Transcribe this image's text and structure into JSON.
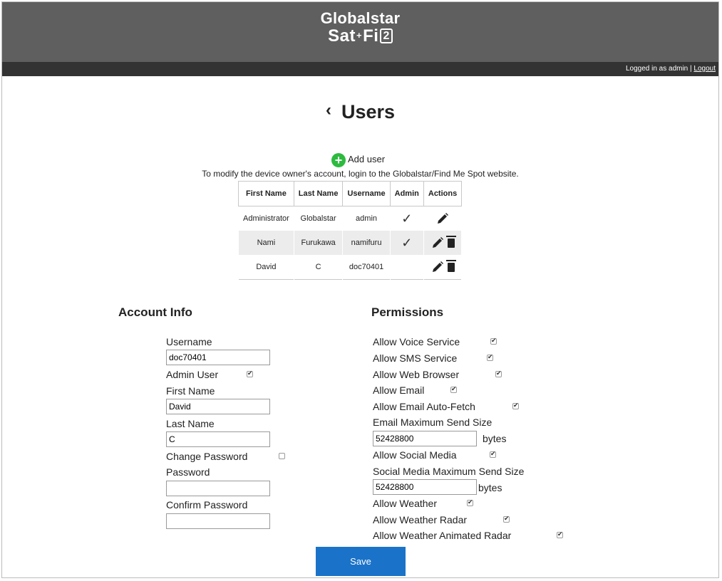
{
  "header": {
    "logo_line1": "Globalstar",
    "logo_line2_a": "Sat",
    "logo_line2_plus": "+",
    "logo_line2_b": "Fi",
    "logo_line2_num": "2",
    "status_text": "Logged in as admin | ",
    "logout_label": "Logout",
    "bg_color": "#5f5f5f",
    "status_bg_color": "#333333"
  },
  "page": {
    "back_glyph": "‹",
    "title": "Users",
    "add_user_label": "Add user",
    "notice": "To modify the device owner's account, login to the Globalstar/Find Me Spot website."
  },
  "table": {
    "headers": [
      "First Name",
      "Last Name",
      "Username",
      "Admin",
      "Actions"
    ],
    "rows": [
      {
        "first": "Administrator",
        "last": "Globalstar",
        "username": "admin",
        "admin": "✓",
        "edit": true,
        "delete": false
      },
      {
        "first": "Nami",
        "last": "Furukawa",
        "username": "namifuru",
        "admin": "✓",
        "edit": true,
        "delete": true
      },
      {
        "first": "David",
        "last": "C",
        "username": "doc70401",
        "admin": "",
        "edit": true,
        "delete": true
      }
    ]
  },
  "account": {
    "heading": "Account Info",
    "username_label": "Username",
    "username_value": "doc70401",
    "admin_user_label": "Admin User",
    "admin_user_checked": true,
    "first_name_label": "First Name",
    "first_name_value": "David",
    "last_name_label": "Last Name",
    "last_name_value": "C",
    "change_password_label": "Change Password",
    "change_password_checked": false,
    "password_label": "Password",
    "password_value": "",
    "confirm_password_label": "Confirm Password",
    "confirm_password_value": ""
  },
  "permissions": {
    "heading": "Permissions",
    "voice_label": "Allow Voice Service",
    "sms_label": "Allow SMS Service",
    "web_label": "Allow Web Browser",
    "email_label": "Allow Email",
    "autofetch_label": "Allow Email Auto-Fetch",
    "email_max_label": "Email Maximum Send Size",
    "email_max_value": "52428800",
    "email_max_unit": "bytes",
    "social_label": "Allow Social Media",
    "social_max_label": "Social Media Maximum Send Size",
    "social_max_value": "52428800",
    "social_max_unit": "bytes",
    "weather_label": "Allow Weather",
    "radar_label": "Allow Weather Radar",
    "animated_radar_label": "Allow Weather Animated Radar",
    "checked": {
      "voice": true,
      "sms": true,
      "web": true,
      "email": true,
      "autofetch": true,
      "social": true,
      "weather": true,
      "radar": true,
      "animated_radar": true
    }
  },
  "actions": {
    "save_label": "Save",
    "save_color": "#1a73c8"
  },
  "colors": {
    "add_icon": "#2dbb3f"
  }
}
